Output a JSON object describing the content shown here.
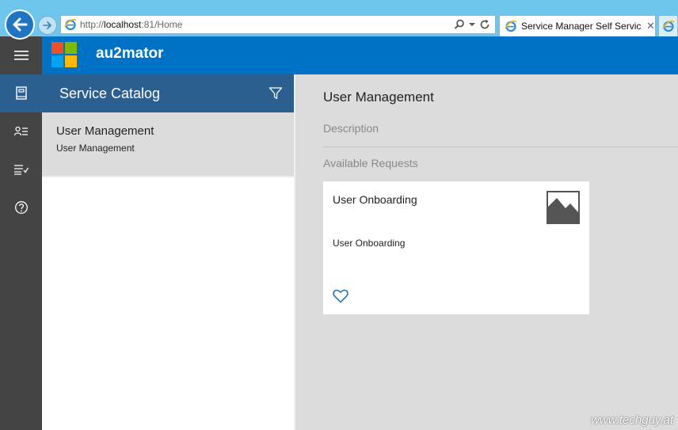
{
  "browser": {
    "url_prefix": "http://",
    "url_host": "localhost",
    "url_rest": ":81/Home",
    "tab_title": "Service Manager Self Servic...",
    "tab_close": "✕"
  },
  "app": {
    "name": "au2mator",
    "brand_color": "#0072c6",
    "rail_color": "#444444",
    "active_color": "#2a5f8f",
    "logo_colors": [
      "#f25022",
      "#7fba00",
      "#00a4ef",
      "#ffb900"
    ]
  },
  "rail": {
    "items": [
      {
        "icon": "catalog-book-icon"
      },
      {
        "icon": "user-list-icon"
      },
      {
        "icon": "checklist-icon"
      },
      {
        "icon": "help-icon"
      }
    ]
  },
  "catalog": {
    "title": "Service Catalog",
    "items": [
      {
        "title": "User Management",
        "subtitle": "User Management"
      }
    ]
  },
  "main": {
    "title": "User Management",
    "description_label": "Description",
    "available_label": "Available Requests",
    "cards": [
      {
        "title": "User Onboarding",
        "description": "User Onboarding"
      }
    ]
  },
  "watermark": "www.techguy.at"
}
